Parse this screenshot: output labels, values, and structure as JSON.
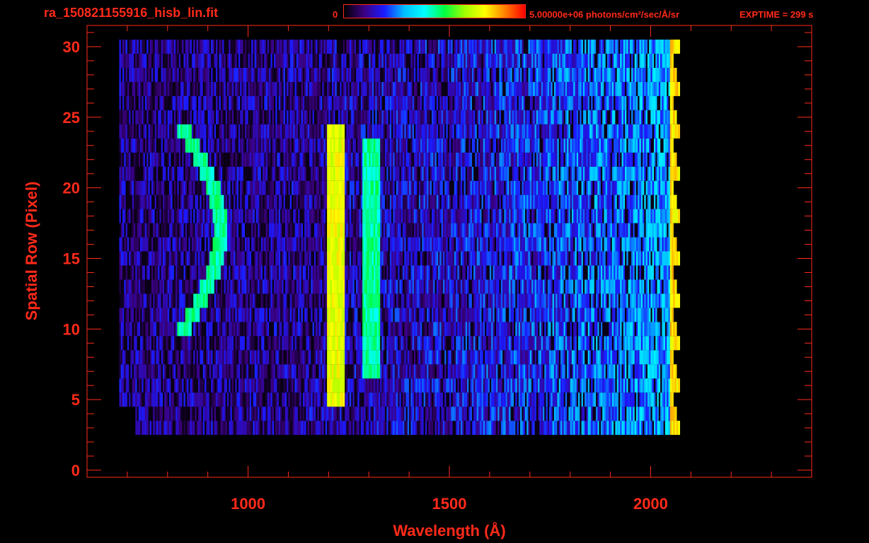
{
  "header": {
    "file_title": "ra_150821155916_hisb_lin.fit",
    "colorbar_min": "0",
    "colorbar_max": "5.00000e+06 photons/cm²/sec/Å/sr",
    "exptime": "EXPTIME = 299 s"
  },
  "colors": {
    "axis": "#ff2a1a",
    "background": "#000000",
    "colormap": [
      "#000000",
      "#3b0080",
      "#1a1aff",
      "#00bfff",
      "#00ffff",
      "#00ff40",
      "#a0ff00",
      "#ffff00",
      "#ff8000",
      "#ff0000"
    ]
  },
  "chart_data": {
    "type": "heatmap",
    "title": "ra_150821155916_hisb_lin.fit",
    "xlabel": "Wavelength (Å)",
    "ylabel": "Spatial Row (Pixel)",
    "xlim": [
      600,
      2400
    ],
    "ylim": [
      -0.5,
      31.5
    ],
    "x_ticks": [
      1000,
      1500,
      2000
    ],
    "y_ticks": [
      0,
      5,
      10,
      15,
      20,
      25,
      30
    ],
    "colorbar_range": [
      0,
      5000000
    ],
    "colorbar_units": "photons/cm²/sec/Å/sr",
    "features": [
      {
        "name": "line",
        "wavelength": 1216,
        "rows": [
          5,
          24
        ],
        "level": 0.75
      },
      {
        "name": "line",
        "wavelength": 1304,
        "rows": [
          7,
          23
        ],
        "level": 0.5
      },
      {
        "name": "arc",
        "wavelength": [
          840,
          930
        ],
        "rows": [
          10,
          24
        ],
        "level": 0.5
      },
      {
        "name": "edge",
        "wavelength": 2060,
        "rows": [
          3,
          30
        ],
        "level": 0.8
      }
    ]
  }
}
